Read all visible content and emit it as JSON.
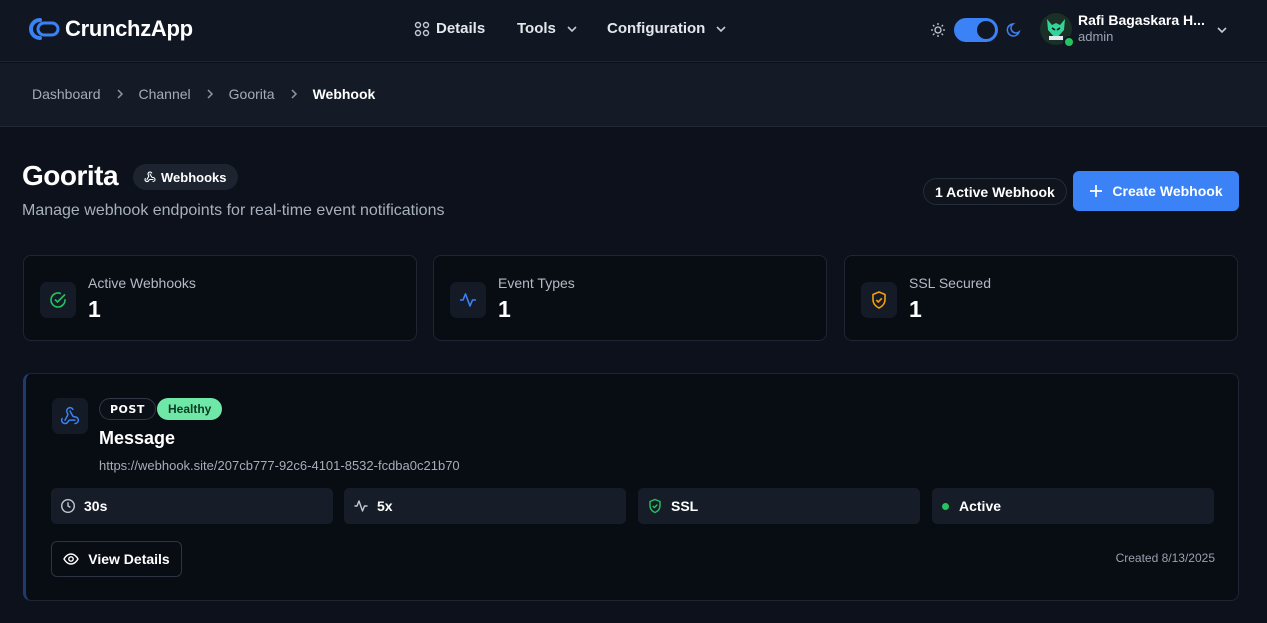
{
  "header": {
    "app_name": "CrunchzApp",
    "nav": [
      {
        "label": "Details",
        "icon": "grid-icon"
      },
      {
        "label": "Tools",
        "icon": "chevron-down-icon"
      },
      {
        "label": "Configuration",
        "icon": "chevron-down-icon"
      }
    ],
    "theme": {
      "mode": "dark",
      "accent": "#3b82f6"
    },
    "user": {
      "name": "Rafi Bagaskara H...",
      "role": "admin",
      "status_color": "#22c55e"
    }
  },
  "breadcrumb": [
    "Dashboard",
    "Channel",
    "Goorita",
    "Webhook"
  ],
  "page": {
    "title": "Goorita",
    "tag": "Webhooks",
    "subtitle": "Manage webhook endpoints for real-time event notifications",
    "active_count_label": "1 Active Webhook",
    "create_button": "Create Webhook"
  },
  "stats": [
    {
      "label": "Active Webhooks",
      "value": "1",
      "icon": "check-circle-icon",
      "color": "#22c55e"
    },
    {
      "label": "Event Types",
      "value": "1",
      "icon": "activity-icon",
      "color": "#3b82f6"
    },
    {
      "label": "SSL Secured",
      "value": "1",
      "icon": "shield-check-icon",
      "color": "#f59e0b"
    }
  ],
  "webhook": {
    "method": "POST",
    "health": "Healthy",
    "name": "Message",
    "url": "https://webhook.site/207cb777-92c6-4101-8532-fcdba0c21b70",
    "chips": [
      {
        "label": "30s",
        "icon": "clock-icon"
      },
      {
        "label": "5x",
        "icon": "activity-icon"
      },
      {
        "label": "SSL",
        "icon": "shield-check-icon"
      },
      {
        "label": "Active",
        "icon": "status-dot-icon"
      }
    ],
    "view_button": "View Details",
    "created": "Created 8/13/2025"
  }
}
